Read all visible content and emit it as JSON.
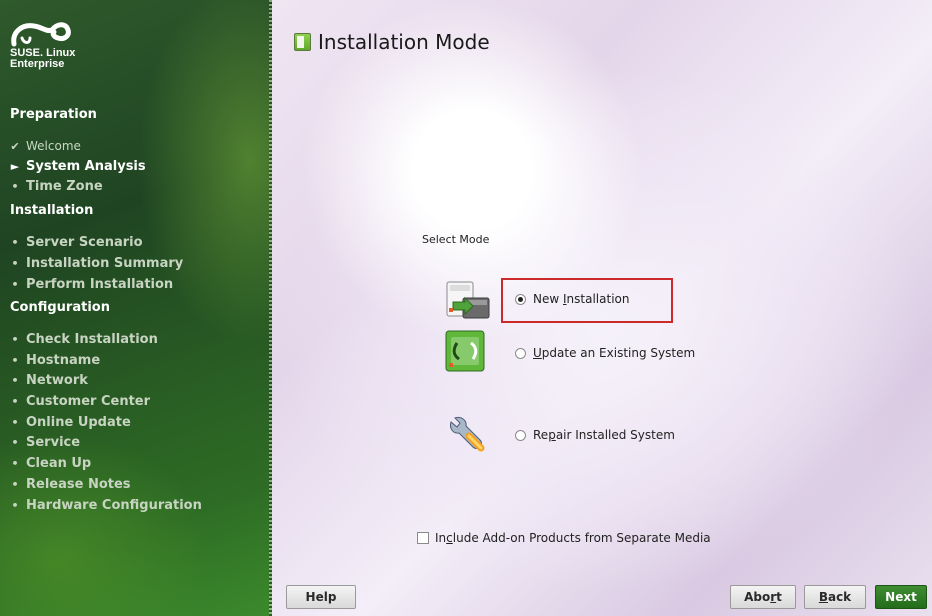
{
  "sidebar": {
    "brand": "SUSE. Linux\nEnterprise",
    "sections": [
      {
        "title": "Preparation",
        "steps": [
          {
            "label": "Welcome",
            "state": "done"
          },
          {
            "label": "System Analysis",
            "state": "current"
          },
          {
            "label": "Time Zone",
            "state": "pending"
          }
        ]
      },
      {
        "title": "Installation",
        "steps": [
          {
            "label": "Server Scenario",
            "state": "pending"
          },
          {
            "label": "Installation Summary",
            "state": "pending"
          },
          {
            "label": "Perform Installation",
            "state": "pending"
          }
        ]
      },
      {
        "title": "Configuration",
        "steps": [
          {
            "label": "Check Installation",
            "state": "pending"
          },
          {
            "label": "Hostname",
            "state": "pending"
          },
          {
            "label": "Network",
            "state": "pending"
          },
          {
            "label": "Customer Center",
            "state": "pending"
          },
          {
            "label": "Online Update",
            "state": "pending"
          },
          {
            "label": "Service",
            "state": "pending"
          },
          {
            "label": "Clean Up",
            "state": "pending"
          },
          {
            "label": "Release Notes",
            "state": "pending"
          },
          {
            "label": "Hardware Configuration",
            "state": "pending"
          }
        ]
      }
    ]
  },
  "main": {
    "title": "Installation Mode",
    "select_label": "Select Mode",
    "options": [
      {
        "pre": "New ",
        "key": "I",
        "post": "nstallation",
        "checked": true,
        "icon": "new-installation-icon"
      },
      {
        "pre": "",
        "key": "U",
        "post": "pdate an Existing System",
        "checked": false,
        "icon": "update-system-icon"
      },
      {
        "pre": "Re",
        "key": "p",
        "post": "air Installed System",
        "checked": false,
        "icon": "repair-system-icon"
      }
    ],
    "addon": {
      "pre": "In",
      "key": "c",
      "post": "lude Add-on Products from Separate Media",
      "checked": false
    }
  },
  "buttons": {
    "help": "Help",
    "abort": {
      "pre": "Abo",
      "key": "r",
      "post": "t"
    },
    "back": {
      "pre": "",
      "key": "B",
      "post": "ack"
    },
    "next": "Next"
  },
  "colors": {
    "sidebar_green": "#285a23",
    "highlight_red": "#cc2a2a",
    "next_button_green": "#236c1c"
  }
}
